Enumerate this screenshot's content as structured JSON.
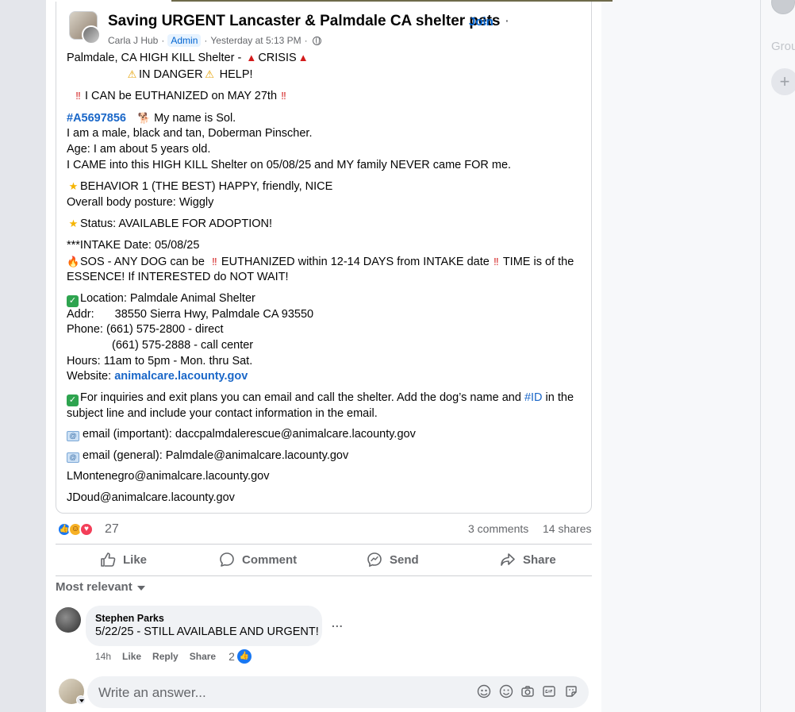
{
  "group": {
    "title": "Saving URGENT Lancaster & Palmdale CA shelter pets",
    "separator": "·",
    "join_label": "Join"
  },
  "meta": {
    "author": "Carla J Hub",
    "dot1": "·",
    "role_badge": "Admin",
    "dot2": "·",
    "time": "Yesterday at 5:13 PM",
    "dot3": "·"
  },
  "post": {
    "l1": "Palmdale, CA HIGH KILL Shelter - ",
    "l1b": "CRISIS",
    "l2": "IN DANGER",
    "l2b": " HELP!",
    "l3": "I CAN be  EUTHANIZED on MAY 27th",
    "id_tag": "#A5697856",
    "name_line": "My name is Sol.",
    "desc1": "I am a male, black and tan, Doberman Pinscher.",
    "desc2": "Age: I am about 5 years old.",
    "desc3": "I CAME into this HIGH KILL Shelter on 05/08/25 and MY family NEVER came FOR me.",
    "behavior": "BEHAVIOR 1 (THE BEST)  HAPPY, friendly, NICE",
    "posture": "Overall body posture:   Wiggly",
    "status": "Status: AVAILABLE FOR ADOPTION!",
    "intake": "***INTAKE Date: 05/08/25",
    "sos_a": "SOS - ANY DOG can be ",
    "sos_b": "EUTHANIZED within 12-14 DAYS from INTAKE date",
    "sos_c": "TIME is of the ESSENCE!  If INTERESTED do NOT WAIT!",
    "location": "Location:  Palmdale Animal Shelter",
    "addr_label": "Addr:",
    "addr_value": "38550 Sierra Hwy, Palmdale CA 93550",
    "phone1": "Phone:  (661) 575-2800 - direct",
    "phone2": "(661) 575-2888 - call center",
    "hours": "Hours:   11am to 5pm - Mon. thru Sat.",
    "website_label": "Website:  ",
    "website_link": "animalcare.lacounty.gov",
    "inquiries_a": "For inquiries and exit plans you can email and call the shelter.  Add the dog’s name and ",
    "inquiries_id": "#ID",
    "inquiries_b": " in the subject line and include your contact information in the email.",
    "email1": "email (important): daccpalmdalerescue@animalcare.lacounty.gov",
    "email2": "email (general): Palmdale@animalcare.lacounty.gov",
    "email3": "LMontenegro@animalcare.lacounty.gov",
    "email4": "JDoud@animalcare.lacounty.gov"
  },
  "stats": {
    "reaction_count": "27",
    "comments": "3 comments",
    "shares": "14 shares"
  },
  "actions": {
    "like": "Like",
    "comment": "Comment",
    "send": "Send",
    "share": "Share"
  },
  "sort": {
    "label": "Most relevant"
  },
  "comment": {
    "author": "Stephen Parks",
    "text": "5/22/25 - STILL AVAILABLE AND URGENT!",
    "more": "...",
    "time": "14h",
    "like": "Like",
    "reply": "Reply",
    "share": "Share",
    "like_count": "2"
  },
  "answer": {
    "placeholder": "Write an answer..."
  },
  "right_panel": {
    "groups_label": "Grou",
    "add_symbol": "+"
  },
  "icons": {
    "globe": "globe-icon",
    "like": "thumbs-up-icon",
    "comment": "speech-bubble-icon",
    "send": "messenger-icon",
    "share": "share-arrow-icon",
    "caret": "caret-down-icon",
    "avatar": "avatar-icon",
    "gif": "gif-icon",
    "camera": "camera-icon",
    "smiley": "smiley-icon",
    "sticker": "sticker-icon"
  },
  "colors": {
    "accent": "#0064d1",
    "link": "#1a67c8",
    "muted": "#65676b",
    "bubble": "#f0f2f5",
    "background": "#ebedf0"
  }
}
